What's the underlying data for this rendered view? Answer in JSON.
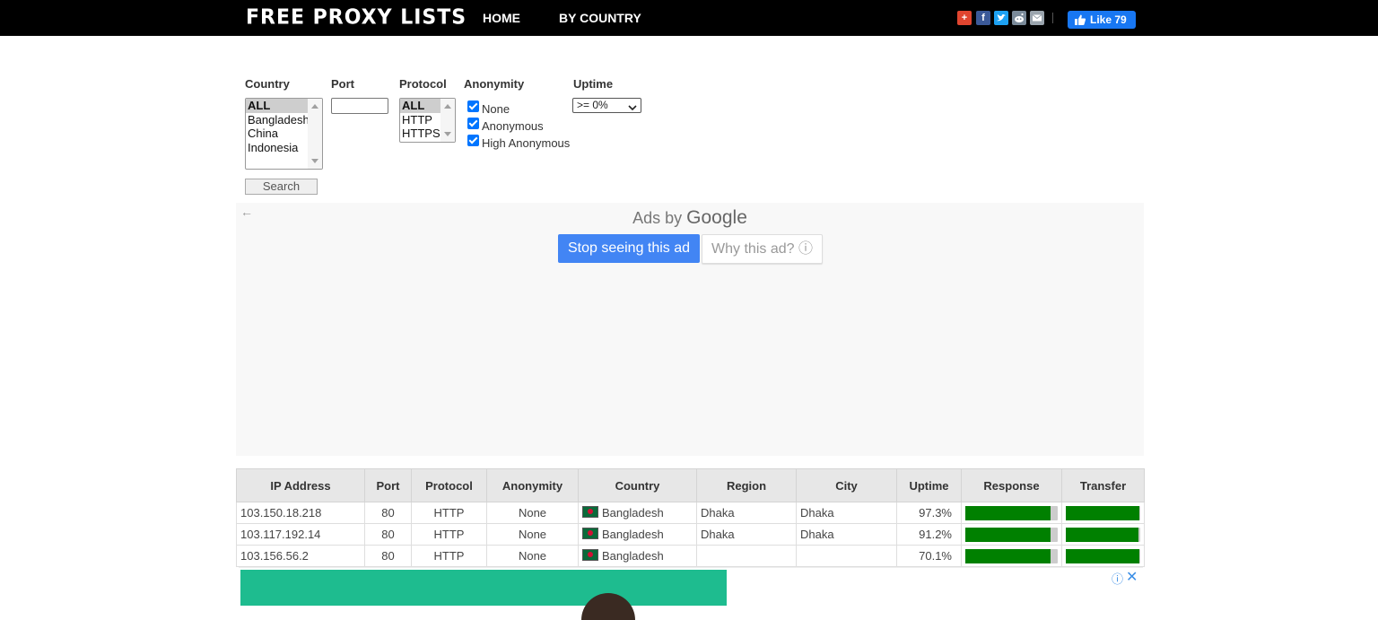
{
  "header": {
    "logo": "FREE PROXY LISTS",
    "nav": [
      "HOME",
      "BY COUNTRY"
    ],
    "fb_like_label": "Like 79"
  },
  "filters": {
    "country": {
      "label": "Country",
      "options": [
        "ALL",
        "Bangladesh",
        "China",
        "Indonesia"
      ]
    },
    "port": {
      "label": "Port",
      "value": ""
    },
    "protocol": {
      "label": "Protocol",
      "options": [
        "ALL",
        "HTTP",
        "HTTPS"
      ]
    },
    "anonymity": {
      "label": "Anonymity",
      "options": [
        "None",
        "Anonymous",
        "High Anonymous"
      ]
    },
    "uptime": {
      "label": "Uptime",
      "value": ">= 0%"
    },
    "search_label": "Search"
  },
  "ad": {
    "ads_by": "Ads by",
    "google": "Google",
    "stop": "Stop seeing this ad",
    "why": "Why this ad? ⓘ"
  },
  "table": {
    "headers": [
      "IP Address",
      "Port",
      "Protocol",
      "Anonymity",
      "Country",
      "Region",
      "City",
      "Uptime",
      "Response",
      "Transfer"
    ],
    "rows": [
      {
        "ip": "103.150.18.218",
        "port": "80",
        "protocol": "HTTP",
        "anonymity": "None",
        "country": "Bangladesh",
        "region": "Dhaka",
        "city": "Dhaka",
        "uptime": "97.3%",
        "response": 0.92,
        "transfer": 0.99
      },
      {
        "ip": "103.117.192.14",
        "port": "80",
        "protocol": "HTTP",
        "anonymity": "None",
        "country": "Bangladesh",
        "region": "Dhaka",
        "city": "Dhaka",
        "uptime": "91.2%",
        "response": 0.92,
        "transfer": 0.97
      },
      {
        "ip": "103.156.56.2",
        "port": "80",
        "protocol": "HTTP",
        "anonymity": "None",
        "country": "Bangladesh",
        "region": "",
        "city": "",
        "uptime": "70.1%",
        "response": 0.92,
        "transfer": 0.99
      }
    ]
  },
  "colors": {
    "accent_blue": "#4285f4",
    "bar_fill": "#008000",
    "fb_blue": "#1877f2"
  },
  "icons": [
    "google-plus-icon",
    "facebook-icon",
    "twitter-icon",
    "reddit-icon",
    "email-icon",
    "thumbs-up-icon",
    "back-arrow-icon",
    "info-icon",
    "close-icon",
    "chevron-down-icon"
  ]
}
